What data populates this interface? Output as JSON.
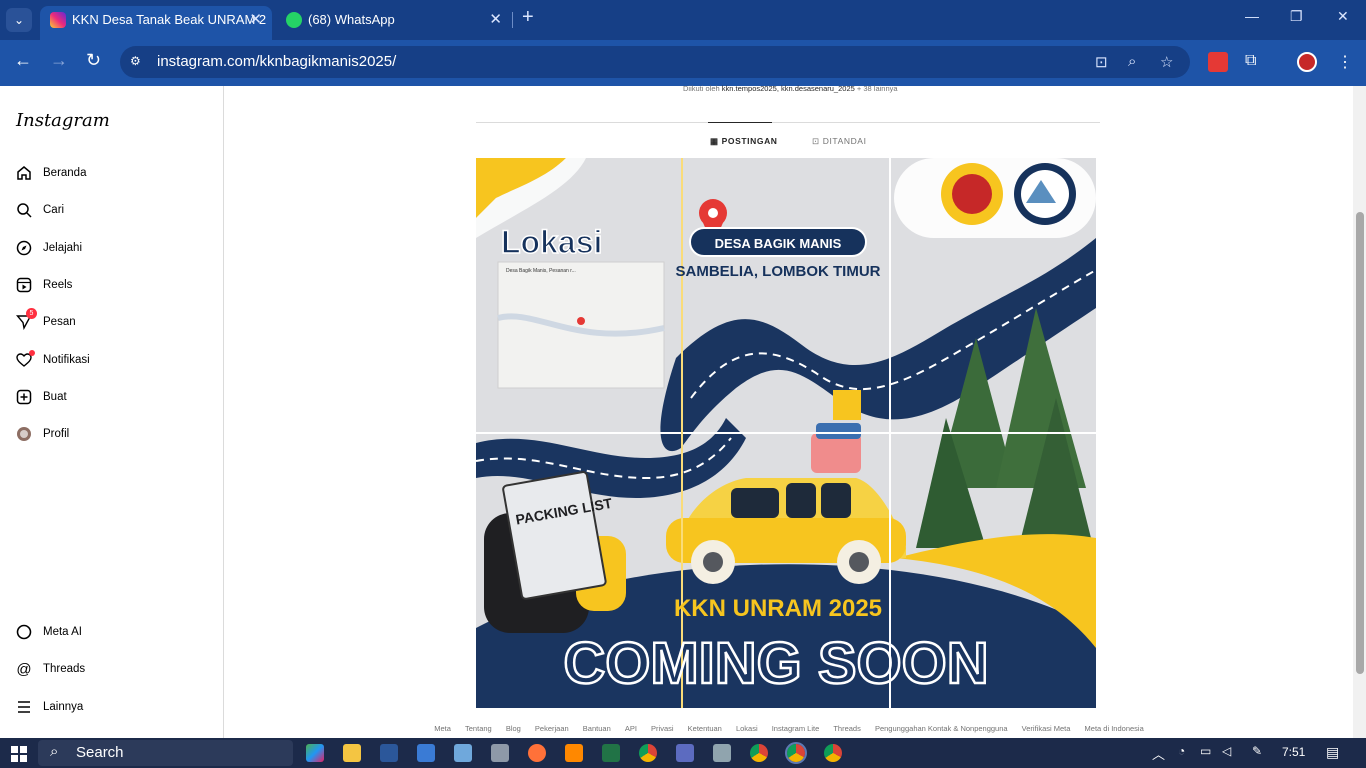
{
  "browser": {
    "tabs": [
      {
        "title": "KKN Desa Tanak Beak UNRAM 2",
        "active": true,
        "icon": "instagram-icon"
      },
      {
        "title": "(68) WhatsApp",
        "active": false,
        "icon": "whatsapp-icon"
      }
    ],
    "url": "instagram.com/kknbagikmanis2025/"
  },
  "sidebar": {
    "logo": "Instagram",
    "items": [
      {
        "label": "Beranda",
        "icon": "home-icon"
      },
      {
        "label": "Cari",
        "icon": "search-icon"
      },
      {
        "label": "Jelajahi",
        "icon": "compass-icon"
      },
      {
        "label": "Reels",
        "icon": "reels-icon"
      },
      {
        "label": "Pesan",
        "icon": "messenger-icon",
        "badge": "5"
      },
      {
        "label": "Notifikasi",
        "icon": "heart-icon"
      },
      {
        "label": "Buat",
        "icon": "plus-square-icon"
      },
      {
        "label": "Profil",
        "icon": "avatar-icon"
      }
    ],
    "bottom": [
      {
        "label": "Meta AI",
        "icon": "meta-ai-icon"
      },
      {
        "label": "Threads",
        "icon": "threads-icon"
      },
      {
        "label": "Lainnya",
        "icon": "menu-icon"
      }
    ]
  },
  "profile": {
    "followed_prefix": "Diikuti oleh",
    "followed_names": "kkn.tempos2025, kkn.desasenaru_2025",
    "followed_more": "+ 38 lainnya"
  },
  "tabs": {
    "posts": "POSTINGAN",
    "tagged": "DITANDAI"
  },
  "post": {
    "lokasi": "Lokasi",
    "village": "DESA BAGIK MANIS",
    "district": "SAMBELIA, LOMBOK TIMUR",
    "map_title": "Desa Bagik Manis, Pesanan r...",
    "packing": "PACKING LIST",
    "kkn": "KKN UNRAM 2025",
    "coming": "COMING SOON"
  },
  "footer": [
    "Meta",
    "Tentang",
    "Blog",
    "Pekerjaan",
    "Bantuan",
    "API",
    "Privasi",
    "Ketentuan",
    "Lokasi",
    "Instagram Lite",
    "Threads",
    "Pengunggahan Kontak & Nonpengguna",
    "Verifikasi Meta",
    "Meta di Indonesia"
  ],
  "taskbar": {
    "search": "Search",
    "time": "7:51"
  },
  "colors": {
    "chrome_dark": "#163f86",
    "chrome_mid": "#1e54a8",
    "navy": "#16325c",
    "yellow": "#f7c51f"
  }
}
